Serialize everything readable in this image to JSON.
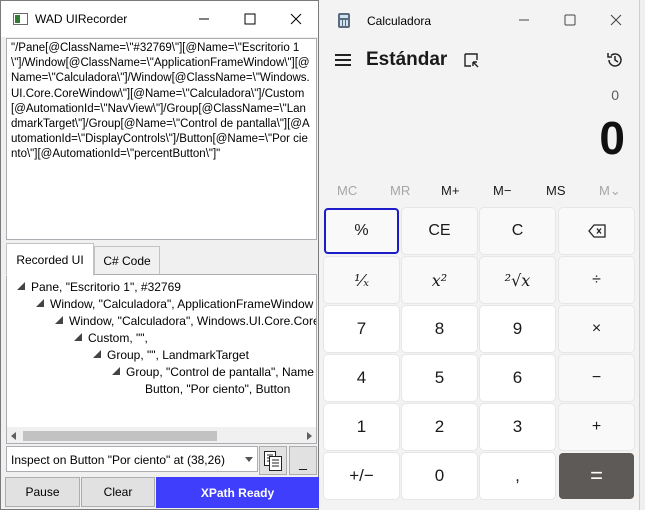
{
  "recorder": {
    "title": "WAD UIRecorder",
    "xpath": "\"/Pane[@ClassName=\\\"#32769\\\"][@Name=\\\"Escritorio 1\\\"]/Window[@ClassName=\\\"ApplicationFrameWindow\\\"][@Name=\\\"Calculadora\\\"]/Window[@ClassName=\\\"Windows.UI.Core.CoreWindow\\\"][@Name=\\\"Calculadora\\\"]/Custom[@AutomationId=\\\"NavView\\\"]/Group[@ClassName=\\\"LandmarkTarget\\\"]/Group[@Name=\\\"Control de pantalla\\\"][@AutomationId=\\\"DisplayControls\\\"]/Button[@Name=\\\"Por ciento\\\"][@AutomationId=\\\"percentButton\\\"]\"",
    "tabs": {
      "recorded_ui": "Recorded UI",
      "csharp_code": "C# Code"
    },
    "tree": [
      "Pane, \"Escritorio 1\", #32769",
      "Window, \"Calculadora\", ApplicationFrameWindow",
      "Window, \"Calculadora\", Windows.UI.Core.CoreWindow",
      "Custom, \"\",",
      "Group, \"\", LandmarkTarget",
      "Group, \"Control de pantalla\", Name",
      "Button, \"Por ciento\", Button"
    ],
    "inspect": "Inspect on Button \"Por ciento\" at (38,26)",
    "minimize_label": "_",
    "pause_label": "Pause",
    "clear_label": "Clear",
    "status": "XPath Ready"
  },
  "calculator": {
    "title": "Calculadora",
    "mode": "Estándar",
    "expression": "0",
    "display": "0",
    "memory": [
      "MC",
      "MR",
      "M+",
      "M−",
      "MS",
      "M⌄"
    ],
    "keys": {
      "percent": "%",
      "ce": "CE",
      "c": "C",
      "reciprocal": "¹⁄ₓ",
      "square": "x²",
      "sqrt": "²√x",
      "divide": "÷",
      "k7": "7",
      "k8": "8",
      "k9": "9",
      "multiply": "×",
      "k4": "4",
      "k5": "5",
      "k6": "6",
      "minus": "−",
      "k1": "1",
      "k2": "2",
      "k3": "3",
      "plus": "+",
      "negate": "+/−",
      "k0": "0",
      "decimal": ",",
      "equals": "="
    }
  },
  "colors": {
    "status_bg": "#3e3efc",
    "focus_border": "#1c1cc8",
    "equals_bg": "#5e5a57"
  }
}
